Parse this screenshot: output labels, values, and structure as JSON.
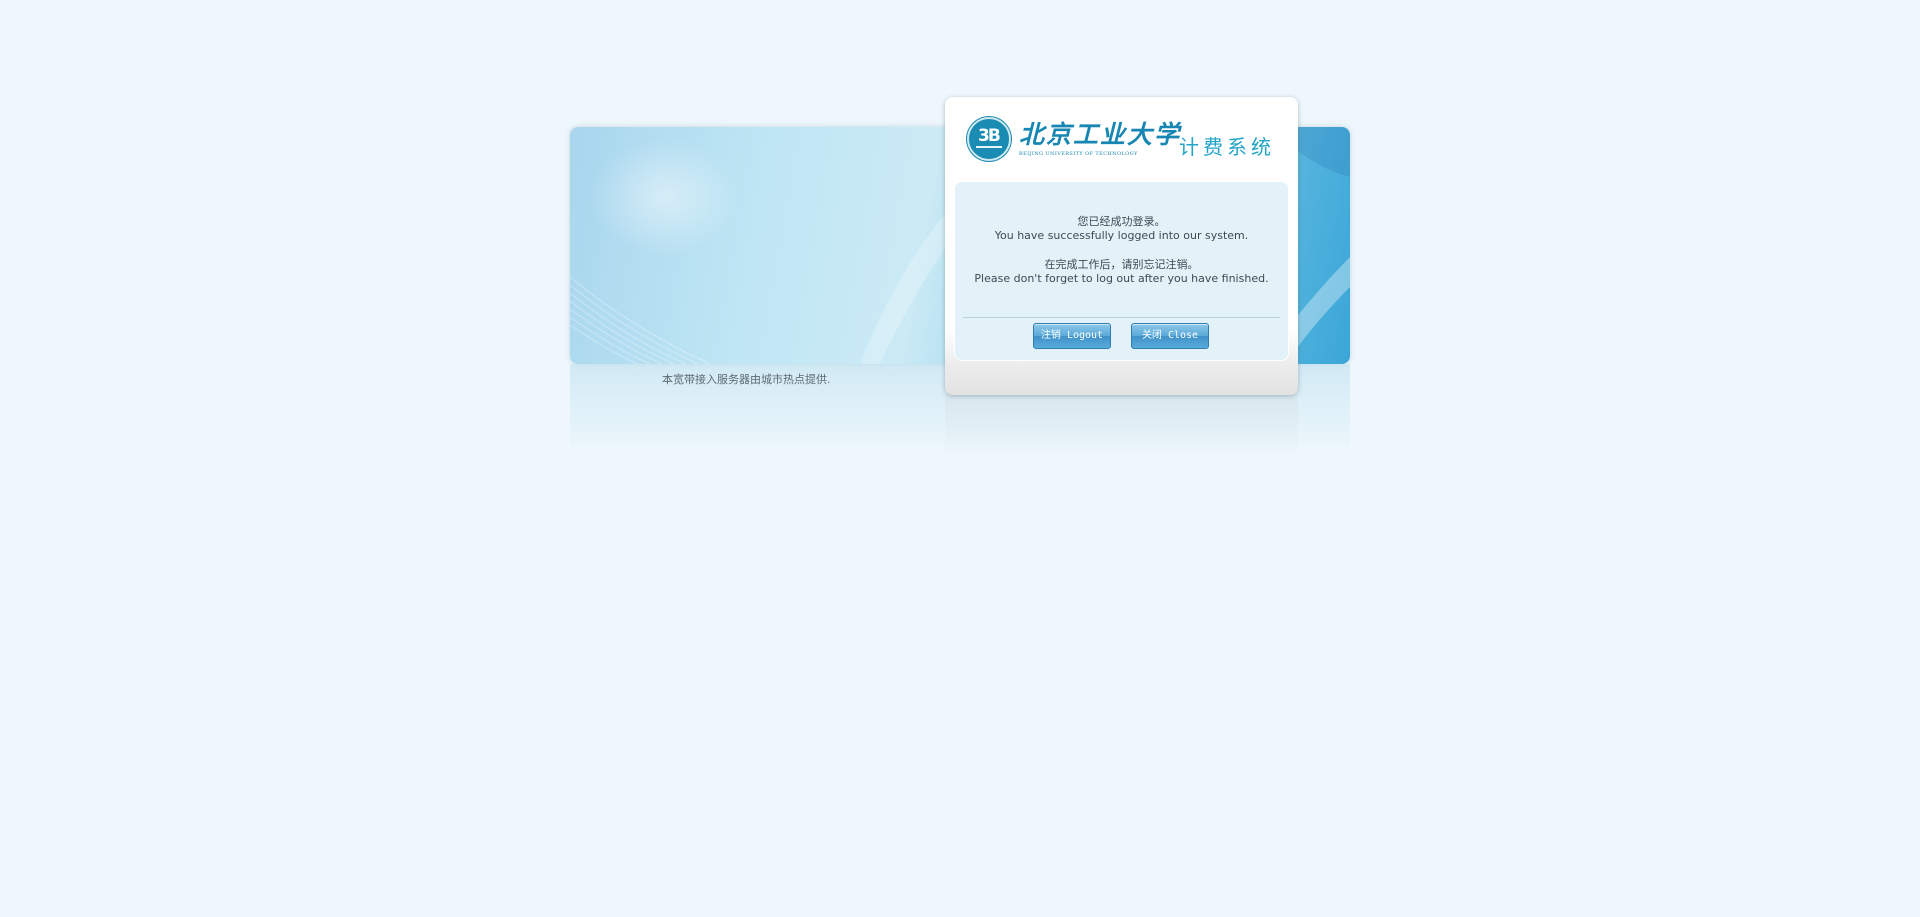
{
  "banner": {
    "provider_note": "本宽带接入服务器由城市热点提供."
  },
  "header": {
    "university_name": "北京工业大学",
    "university_name_en": "BEIJING UNIVERSITY OF TECHNOLOGY",
    "system_name": "计费系统",
    "emblem_glyph": "3B"
  },
  "message": {
    "success_zh": "您已经成功登录。",
    "success_en": "You have successfully logged into our system.",
    "reminder_zh": "在完成工作后，请别忘记注销。",
    "reminder_en": "Please don't forget to log out after you have finished."
  },
  "buttons": {
    "logout_label": "注销 Logout",
    "close_label": "关闭 Close"
  },
  "colors": {
    "page_background": "#eef7fc",
    "brand_blue": "#1786b3",
    "button_blue": "#5aa9d8"
  }
}
